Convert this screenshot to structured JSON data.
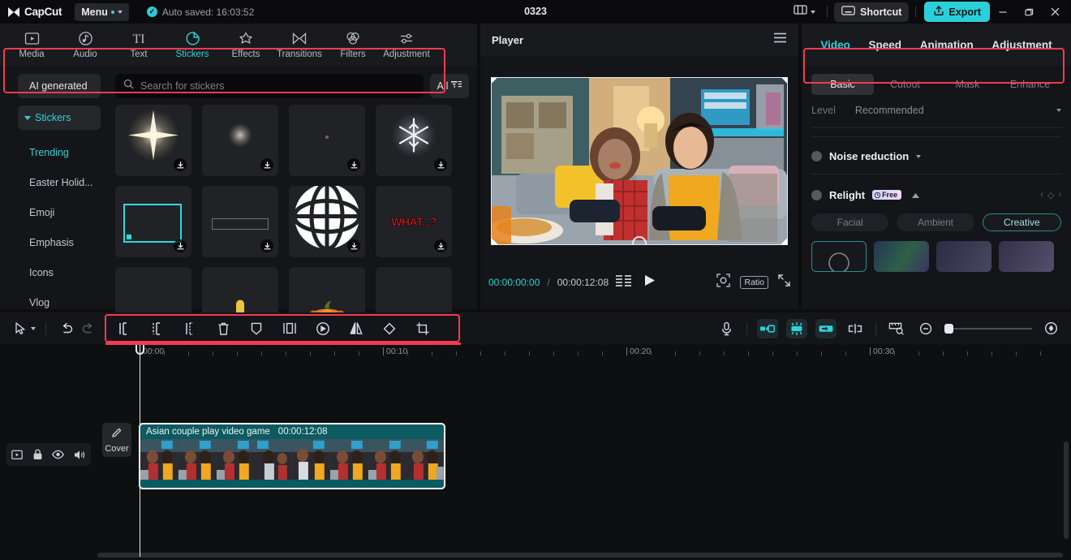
{
  "titlebar": {
    "brand": "CapCut",
    "menu_label": "Menu",
    "autosave": "Auto saved: 16:03:52",
    "project_title": "0323",
    "shortcut_label": "Shortcut",
    "export_label": "Export",
    "layout_icon": "layout-icon",
    "minimize_icon": "minimize-icon",
    "maximize_icon": "maximize-icon",
    "close_icon": "close-icon"
  },
  "media_tabs": [
    {
      "label": "Media",
      "icon": "media-icon",
      "active": false
    },
    {
      "label": "Audio",
      "icon": "audio-icon",
      "active": false
    },
    {
      "label": "Text",
      "icon": "text-icon",
      "active": false
    },
    {
      "label": "Stickers",
      "icon": "stickers-icon",
      "active": true
    },
    {
      "label": "Effects",
      "icon": "effects-icon",
      "active": false
    },
    {
      "label": "Transitions",
      "icon": "transitions-icon",
      "active": false
    },
    {
      "label": "Filters",
      "icon": "filters-icon",
      "active": false
    },
    {
      "label": "Adjustment",
      "icon": "adjustment-icon",
      "active": false
    }
  ],
  "library": {
    "search_placeholder": "Search for stickers",
    "filter_label": "All",
    "ai_generated": "AI generated",
    "group_label": "Stickers",
    "categories": [
      {
        "label": "Trending",
        "active": true
      },
      {
        "label": "Easter Holid...",
        "active": false
      },
      {
        "label": "Emoji",
        "active": false
      },
      {
        "label": "Emphasis",
        "active": false
      },
      {
        "label": "Icons",
        "active": false
      },
      {
        "label": "Vlog",
        "active": false
      }
    ],
    "sticker_rows": [
      [
        {
          "kind": "sparkle-star",
          "download": true
        },
        {
          "kind": "soft-glow",
          "download": true
        },
        {
          "kind": "tiny-dot",
          "download": true
        },
        {
          "kind": "snowflake",
          "download": true
        }
      ],
      [
        {
          "kind": "cyan-frame",
          "download": true
        },
        {
          "kind": "grey-bar",
          "download": true
        },
        {
          "kind": "globe",
          "download": true
        },
        {
          "kind": "what-text",
          "label": "WHAT...?",
          "download": true
        }
      ],
      [
        {
          "kind": "dark-shape",
          "download": false
        },
        {
          "kind": "yellow-bar",
          "download": false
        },
        {
          "kind": "pumpkin",
          "download": false
        },
        {
          "kind": "blank",
          "download": false
        }
      ]
    ]
  },
  "player": {
    "title": "Player",
    "menu_icon": "hamburger-icon",
    "current_time": "00:00:00:00",
    "separator": "/",
    "total_time": "00:00:12:08",
    "play_icon": "play-icon",
    "frames_icon": "frames-icon",
    "fit_icon": "fit-screen-icon",
    "ratio_label": "Ratio",
    "fullscreen_icon": "fullscreen-icon"
  },
  "properties": {
    "tabs": [
      {
        "label": "Video",
        "active": true
      },
      {
        "label": "Speed",
        "active": false
      },
      {
        "label": "Animation",
        "active": false
      },
      {
        "label": "Adjustment",
        "active": false
      }
    ],
    "segments": [
      {
        "label": "Basic",
        "active": true
      },
      {
        "label": "Cutout",
        "active": false
      },
      {
        "label": "Mask",
        "active": false
      },
      {
        "label": "Enhance",
        "active": false
      }
    ],
    "level_label": "Level",
    "level_value": "Recommended",
    "noise_reduction_label": "Noise reduction",
    "relight_label": "Relight",
    "relight_badge": "Free",
    "relight_chips": [
      {
        "label": "Facial",
        "selected": false
      },
      {
        "label": "Ambient",
        "selected": false
      },
      {
        "label": "Creative",
        "selected": true
      }
    ],
    "relight_thumbs": [
      "none",
      "preset-1",
      "preset-2",
      "preset-3"
    ]
  },
  "toolbar": {
    "pointer_icon": "pointer-icon",
    "undo_icon": "undo-icon",
    "redo_icon": "redo-icon",
    "tools": [
      {
        "name": "split-icon",
        "label": "Split"
      },
      {
        "name": "split-left-icon",
        "label": "Delete left"
      },
      {
        "name": "split-right-icon",
        "label": "Delete right"
      },
      {
        "name": "delete-icon",
        "label": "Delete"
      },
      {
        "name": "marker-icon",
        "label": "Marker"
      },
      {
        "name": "freeze-icon",
        "label": "Freeze"
      },
      {
        "name": "reverse-icon",
        "label": "Reverse"
      },
      {
        "name": "mirror-icon",
        "label": "Mirror"
      },
      {
        "name": "rotate-icon",
        "label": "Rotate"
      },
      {
        "name": "crop-icon",
        "label": "Crop"
      }
    ],
    "right_tools": [
      {
        "name": "record-voiceover-icon",
        "active": false
      },
      {
        "name": "auto-cut-start-icon",
        "active": true
      },
      {
        "name": "auto-cut-mid-icon",
        "active": true
      },
      {
        "name": "auto-cut-end-icon",
        "active": true
      },
      {
        "name": "link-split-icon",
        "active": false
      },
      {
        "name": "preview-axis-icon",
        "active": false
      },
      {
        "name": "zoom-out-icon",
        "active": false
      },
      {
        "name": "zoom-fit-icon",
        "active": false
      }
    ]
  },
  "timeline": {
    "ruler_labels": [
      "00:00",
      "00:10",
      "00:20",
      "00:30"
    ],
    "track_icons": [
      "track-type-icon",
      "lock-icon",
      "eye-icon",
      "volume-icon"
    ],
    "cover_label": "Cover",
    "cover_icon": "pencil-icon",
    "clip": {
      "name": "Asian couple play video game",
      "duration": "00:00:12:08"
    }
  },
  "colors": {
    "accent": "#2ed3d9",
    "highlight_box": "#f23b52",
    "clip_bg": "#0c5b60",
    "export": "#2ad0d9"
  }
}
